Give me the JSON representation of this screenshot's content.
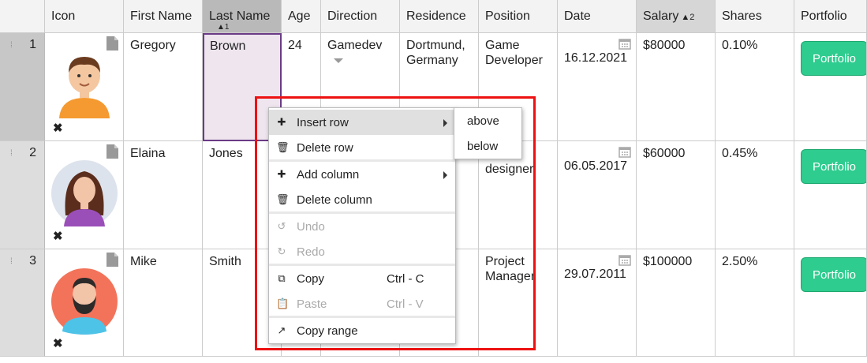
{
  "headers": [
    "Icon",
    "First Name",
    "Last Name",
    "Age",
    "Direction",
    "Residence",
    "Position",
    "Date",
    "Salary",
    "Shares",
    "Portfolio"
  ],
  "sort_last_name": {
    "arrow": "▲",
    "order": "1"
  },
  "sort_salary": {
    "arrow": "▲",
    "order": "2"
  },
  "rows": [
    {
      "num": "1",
      "first": "Gregory",
      "last": "Brown",
      "age": "24",
      "direction": "Gamedev",
      "residence": "Dortmund, Germany",
      "position": "Game Developer",
      "date": "16.12.2021",
      "salary": "$80000",
      "shares": "0.10%",
      "portfolio": "Portfolio"
    },
    {
      "num": "2",
      "first": "Elaina",
      "last": "Jones",
      "age": "",
      "direction": "",
      "residence": "",
      "position": "designer",
      "date": "06.05.2017",
      "salary": "$60000",
      "shares": "0.45%",
      "portfolio": "Portfolio"
    },
    {
      "num": "3",
      "first": "Mike",
      "last": "Smith",
      "age": "",
      "direction": "",
      "residence": "",
      "position": "Project Manager",
      "date": "29.07.2011",
      "salary": "$100000",
      "shares": "2.50%",
      "portfolio": "Portfolio"
    }
  ],
  "context_menu": {
    "insert_row": "Insert row",
    "delete_row": "Delete row",
    "add_column": "Add column",
    "delete_column": "Delete column",
    "undo": "Undo",
    "redo": "Redo",
    "copy": "Copy",
    "copy_shortcut": "Ctrl - C",
    "paste": "Paste",
    "paste_shortcut": "Ctrl - V",
    "copy_range": "Copy range"
  },
  "submenu": {
    "above": "above",
    "below": "below"
  },
  "colors": {
    "accent": "#2ecc8e",
    "selection_border": "#6b3b86",
    "highlight": "#ee1111"
  }
}
